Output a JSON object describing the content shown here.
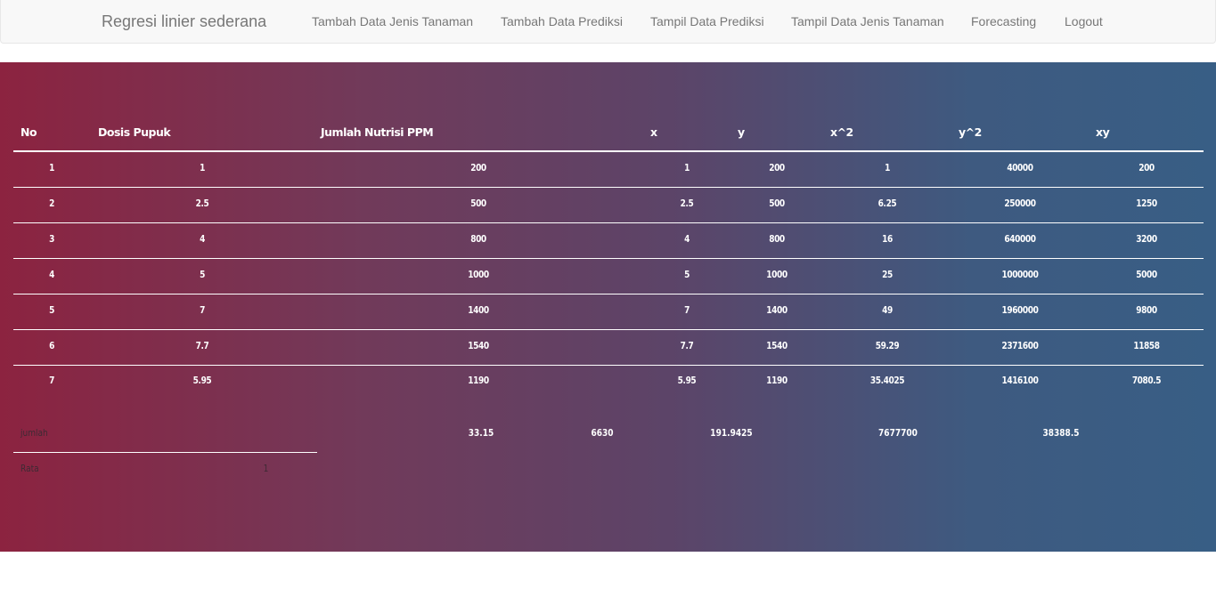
{
  "navbar": {
    "brand": "Regresi linier sederana",
    "links": [
      "Tambah Data Jenis Tanaman",
      "Tambah Data Prediksi",
      "Tampil Data Prediksi",
      "Tampil Data Jenis Tanaman",
      "Forecasting",
      "Logout"
    ]
  },
  "table": {
    "headers": [
      "No",
      "Dosis Pupuk",
      "Jumlah Nutrisi PPM",
      "x",
      "y",
      "x^2",
      "y^2",
      "xy"
    ],
    "rows": [
      [
        "1",
        "1",
        "200",
        "1",
        "200",
        "1",
        "40000",
        "200"
      ],
      [
        "2",
        "2.5",
        "500",
        "2.5",
        "500",
        "6.25",
        "250000",
        "1250"
      ],
      [
        "3",
        "4",
        "800",
        "4",
        "800",
        "16",
        "640000",
        "3200"
      ],
      [
        "4",
        "5",
        "1000",
        "5",
        "1000",
        "25",
        "1000000",
        "5000"
      ],
      [
        "5",
        "7",
        "1400",
        "7",
        "1400",
        "49",
        "1960000",
        "9800"
      ],
      [
        "6",
        "7.7",
        "1540",
        "7.7",
        "1540",
        "59.29",
        "2371600",
        "11858"
      ],
      [
        "7",
        "5.95",
        "1190",
        "5.95",
        "1190",
        "35.4025",
        "1416100",
        "7080.5"
      ]
    ]
  },
  "summary": {
    "jumlah_label": "jumlah",
    "jumlah_values": [
      "33.15",
      "6630",
      "191.9425",
      "7677700",
      "38388.5"
    ],
    "rata_label": "Rata",
    "rata_value": "1"
  }
}
